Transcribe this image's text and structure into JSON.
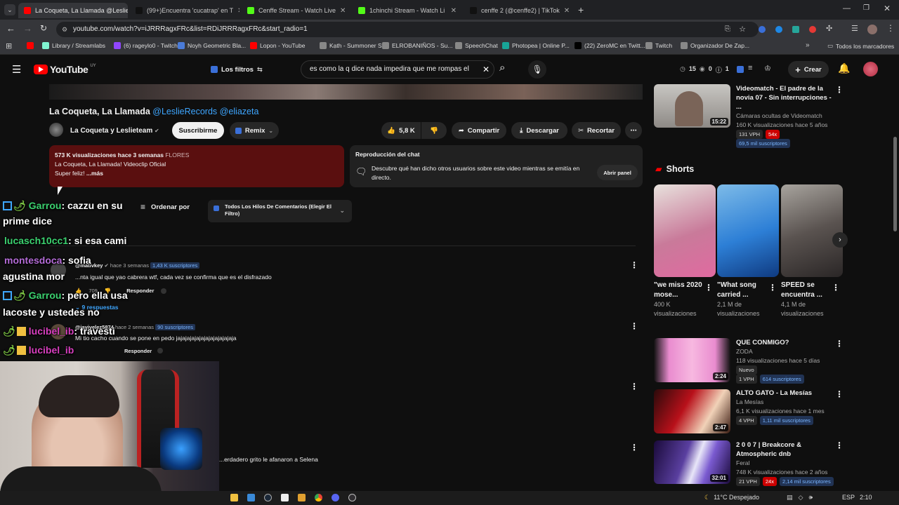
{
  "tabs": [
    {
      "title": "La Coqueta, La Llamada @Leslie",
      "color": "#ff0000",
      "active": true
    },
    {
      "title": "(99+)Encuentra 'cucatrap' en T",
      "color": "#111111",
      "active": false
    },
    {
      "title": "Cenffe Stream - Watch Live",
      "color": "#53fc18",
      "active": false
    },
    {
      "title": "1chinchi Stream - Watch Li",
      "color": "#53fc18",
      "active": false
    },
    {
      "title": "cenffe 2 (@cenffe2) | TikTok",
      "color": "#111111",
      "active": false
    }
  ],
  "url": "youtube.com/watch?v=iJRRRagxFRc&list=RDiJRRRagxFRc&start_radio=1",
  "bookmarks": [
    {
      "label": "Library / Streamlabs",
      "color": "#80f5d2"
    },
    {
      "label": "(6) rageylo0 - Twitch",
      "color": "#9146ff"
    },
    {
      "label": "Noyh Geometric Bla...",
      "color": "#4a7bd8"
    },
    {
      "label": "Lopon - YouTube",
      "color": "#ff0000"
    },
    {
      "label": "Kạth - Summoner St...",
      "color": "#888888"
    },
    {
      "label": "ELROBANIÑOS - Su...",
      "color": "#888888"
    },
    {
      "label": "SpeechChat",
      "color": "#888888"
    },
    {
      "label": "Photopea | Online P...",
      "color": "#18a497"
    },
    {
      "label": "(22) ZeroMC en Twitt...",
      "color": "#000000"
    },
    {
      "label": "Twitch",
      "color": "#888888"
    },
    {
      "label": "Organizador De Zap...",
      "color": "#888888"
    }
  ],
  "bookmarks_all": "Todos los marcadores",
  "yt": {
    "logo": "YouTube",
    "region": "UY",
    "filters": "Los filtros",
    "search_value": "es como la q dice nada impedira que me rompas el",
    "stats": {
      "a": "15",
      "b": "0",
      "c": "1"
    },
    "create": "Crear"
  },
  "video": {
    "title_plain": "La Coqueta, La Llamada",
    "title_tags": "@LeslieRecords @eliazeta",
    "channel": "La Coqueta y Leslieteam",
    "subscribe": "Suscribirme",
    "remix": "Remix",
    "likes": "5,8 K",
    "share": "Compartir",
    "download": "Descargar",
    "clip": "Recortar",
    "desc_stats": "573 K visualizaciones  hace 3 semanas",
    "desc_tag": "FLORES",
    "desc_line1": "La Coqueta,  La Llamada! Videoclip Oficial",
    "desc_line2": "Super feliz!",
    "desc_more": "...más"
  },
  "chat_replay": {
    "title": "Reproducción del chat",
    "text": "Descubre qué han dicho otros usuarios sobre este video mientras se emitía en directo.",
    "button": "Abrir panel"
  },
  "comments": {
    "sort": "Ordenar por",
    "filter": "Todos Los Hilos De Comentarios (Elegir El Filtro)",
    "items": [
      {
        "user": "@mativkey",
        "time": "hace 3 semanas",
        "badge": "1,43 K suscriptores",
        "text": "...nta igual que yao cabrera wtf, cada vez se confirma que es el disfrazado",
        "likes": "709",
        "reply": "Responder",
        "replies": "9 respuestas"
      },
      {
        "user": "@javivelez5874",
        "time": "hace 2 semanas",
        "badge": "90 suscriptores",
        "text": "Mi tio cacho cuando se pone en pedo jajajajajajajajajajajajaja",
        "reply": "Responder"
      },
      {
        "text": "...erdadero grito le afanaron a Selena"
      }
    ]
  },
  "chat_overlay": [
    {
      "user": "Garrou",
      "color": "#3bd16f",
      "msg": ": cazzu en su",
      "icon": "bolt"
    },
    {
      "msg": "prime dice"
    },
    {
      "user": "lucasch10cc1",
      "color": "#3bd16f",
      "msg": ": si esa cami"
    },
    {
      "user": "montesdoca",
      "color": "#b36bd6",
      "msg": ": sofia"
    },
    {
      "msg": "agustina mor"
    },
    {
      "user": "Garrou",
      "color": "#3bd16f",
      "msg": ": pero ella usa",
      "icon": "bolt"
    },
    {
      "msg": "lacoste y ustedes no"
    },
    {
      "user": "lucibel_ib",
      "color": "#d83fbf",
      "msg": ": travesti"
    },
    {
      "user": "lucibel_ib",
      "color": "#d83fbf",
      "msg": ""
    }
  ],
  "sidebar": {
    "top": {
      "title": "Videomatch - El padre de la novia 07 - Sin interrupciones - ...",
      "channel": "Cámaras ocultas de Videomatch",
      "meta": "160 K visualizaciones  hace 5 años",
      "vph": "131 VPH",
      "ratio": "54x",
      "subs": "69,5 mil suscriptores",
      "duration": "15:22"
    },
    "shorts_title": "Shorts",
    "shorts": [
      {
        "title": "\"we miss 2020 mose...",
        "views": "400 K visualizaciones"
      },
      {
        "title": "\"What song carried ...",
        "views": "2,1 M de visualizaciones"
      },
      {
        "title": "SPEED se encuentra ...",
        "views": "4,1 M de visualizaciones"
      }
    ],
    "videos": [
      {
        "title": "QUE CONMIGO?",
        "channel": "ZODA",
        "meta": "118 visualizaciones  hace 5 días",
        "badge": "Nuevo",
        "vph": "1 VPH",
        "subs": "614 suscriptores",
        "duration": "2:24"
      },
      {
        "title": "ALTO GATO - La Mesías",
        "channel": "La Mesías",
        "meta": "6,1 K visualizaciones  hace 1 mes",
        "vph": "4 VPH",
        "subs": "1,11 mil suscriptores",
        "duration": "2:47"
      },
      {
        "title": "2 0 0 7 | Breakcore & Atmospheric dnb",
        "channel": "Feral",
        "meta": "748 K visualizaciones  hace 2 años",
        "vph": "21 VPH",
        "ratio": "24x",
        "subs": "2,14 mil suscriptores",
        "duration": "32:01"
      }
    ]
  },
  "taskbar": {
    "weather": "11°C  Despejado",
    "lang": "ESP",
    "time": "2:10"
  },
  "colors": {
    "accent": "#3ea6ff",
    "red": "#ff0000",
    "desc_bg": "#5a0f0f",
    "vph_red": "#cc0000"
  }
}
